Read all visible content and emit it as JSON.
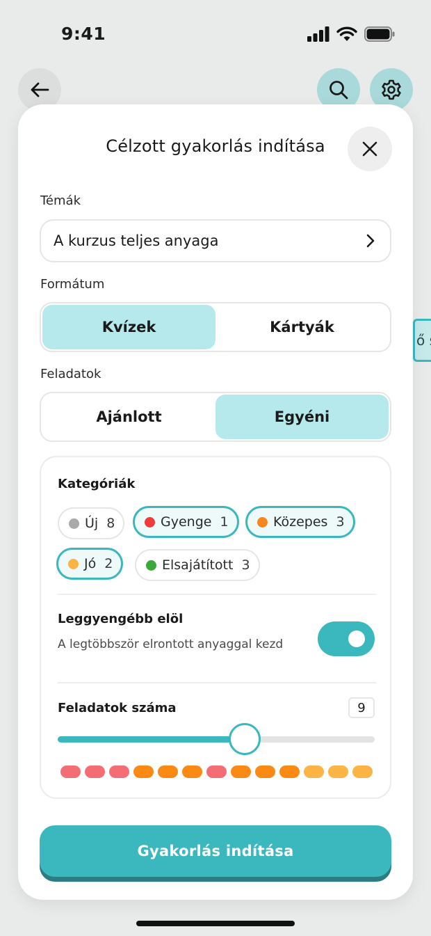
{
  "status_bar": {
    "time": "9:41"
  },
  "peek": {
    "text": "ő s"
  },
  "sheet": {
    "title": "Célzott gyakorlás indítása",
    "topics": {
      "label": "Témák",
      "value": "A kurzus teljes anyaga"
    },
    "format": {
      "label": "Formátum",
      "options": [
        "Kvízek",
        "Kártyák"
      ],
      "selected": "Kvízek"
    },
    "tasks": {
      "label": "Feladatok",
      "options": [
        "Ajánlott",
        "Egyéni"
      ],
      "selected": "Egyéni"
    },
    "categories": {
      "title": "Kategóriák",
      "items": [
        {
          "label": "Új",
          "count": "8",
          "color": "#a9a9a9",
          "selected": false
        },
        {
          "label": "Gyenge",
          "count": "1",
          "color": "#ef3b3b",
          "selected": true
        },
        {
          "label": "Közepes",
          "count": "3",
          "color": "#f7861b",
          "selected": true
        },
        {
          "label": "Jó",
          "count": "2",
          "color": "#fbb444",
          "selected": true
        },
        {
          "label": "Elsajátított",
          "count": "3",
          "color": "#3aa93a",
          "selected": false
        }
      ]
    },
    "weakest_first": {
      "title": "Leggyengébb elöl",
      "description": "A legtöbbször elrontott anyaggal kezd",
      "enabled": true
    },
    "task_count": {
      "title": "Feladatok száma",
      "value": "9",
      "slider_fraction": 0.59,
      "pills": [
        {
          "color": "#f46d75"
        },
        {
          "color": "#f46d75"
        },
        {
          "color": "#f46d75"
        },
        {
          "color": "#fb8a14"
        },
        {
          "color": "#fb8a14"
        },
        {
          "color": "#fb8a14"
        },
        {
          "color": "#f46d75"
        },
        {
          "color": "#fb8a14"
        },
        {
          "color": "#fb8a14"
        },
        {
          "color": "#fb8a14"
        },
        {
          "color": "#fdb447"
        },
        {
          "color": "#fdb447"
        },
        {
          "color": "#fdb447"
        }
      ]
    },
    "start_button": {
      "label": "Gyakorlás indítása"
    }
  },
  "colors": {
    "accent": "#3bb8bd",
    "accent_light": "#b6e9eb"
  }
}
